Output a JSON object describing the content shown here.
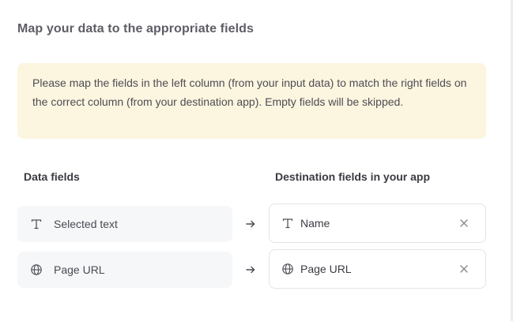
{
  "page": {
    "title": "Map your data to the appropriate fields",
    "notice": "Please map the fields in the left column (from your input data) to match the right fields on the correct column (from your destination app). Empty fields will be skipped."
  },
  "columns": {
    "left_header": "Data fields",
    "right_header": "Destination fields in your app"
  },
  "mappings": [
    {
      "source": {
        "label": "Selected text",
        "icon": "text-type-icon"
      },
      "destination": {
        "label": "Name",
        "icon": "text-type-icon"
      }
    },
    {
      "source": {
        "label": "Page URL",
        "icon": "globe-icon"
      },
      "destination": {
        "label": "Page URL",
        "icon": "globe-icon"
      }
    }
  ],
  "colors": {
    "notice_background": "#fcf5df",
    "source_field_background": "#f6f7f9",
    "destination_border": "#e3e4e8"
  }
}
